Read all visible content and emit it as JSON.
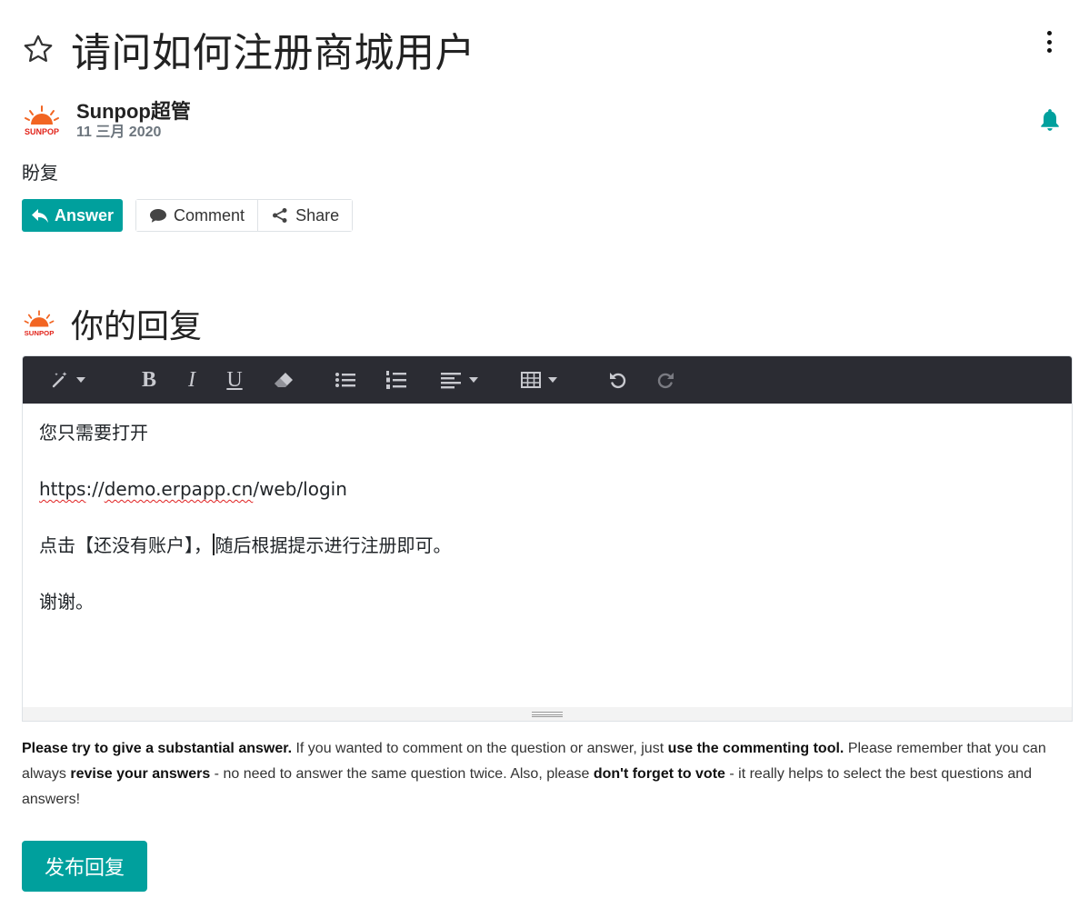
{
  "question": {
    "title": "请问如何注册商城用户",
    "body": "盼复",
    "author": {
      "name": "Sunpop超管",
      "date": "11 三月 2020",
      "logo_text": "SUNPOP"
    },
    "actions": {
      "answer_label": "Answer",
      "comment_label": "Comment",
      "share_label": "Share"
    }
  },
  "reply": {
    "heading": "你的回复",
    "editor": {
      "toolbar": [
        "magic-wand-icon",
        "bold-icon",
        "italic-icon",
        "underline-icon",
        "eraser-icon",
        "bullet-list-icon",
        "numbered-list-icon",
        "align-icon",
        "table-icon",
        "undo-icon",
        "redo-icon"
      ],
      "toolbar_text": {
        "bold": "B",
        "italic": "I",
        "underline": "U"
      },
      "lines": {
        "line1": "您只需要打开",
        "link_a": "https",
        "link_b": "://",
        "link_c": "demo.erpapp.cn",
        "link_d": "/web/login",
        "line3_a": "点击【还没有账户】，",
        "line3_b": "随后根据提示进行注册即可。",
        "line4": "谢谢。"
      }
    },
    "hint": {
      "p1": "Please try to give a substantial answer.",
      "p2": " If you wanted to comment on the question or answer, just ",
      "p3": "use the commenting tool.",
      "p4": " Please remember that you can always ",
      "p5": "revise your answers",
      "p6": " - no need to answer the same question twice. Also, please ",
      "p7": "don't forget to vote",
      "p8": " - it really helps to select the best questions and answers!"
    },
    "submit_label": "发布回复"
  },
  "colors": {
    "accent": "#00a09d",
    "toolbar_bg": "#2b2c33",
    "logo_orange": "#f26522",
    "logo_red": "#e2231a"
  }
}
